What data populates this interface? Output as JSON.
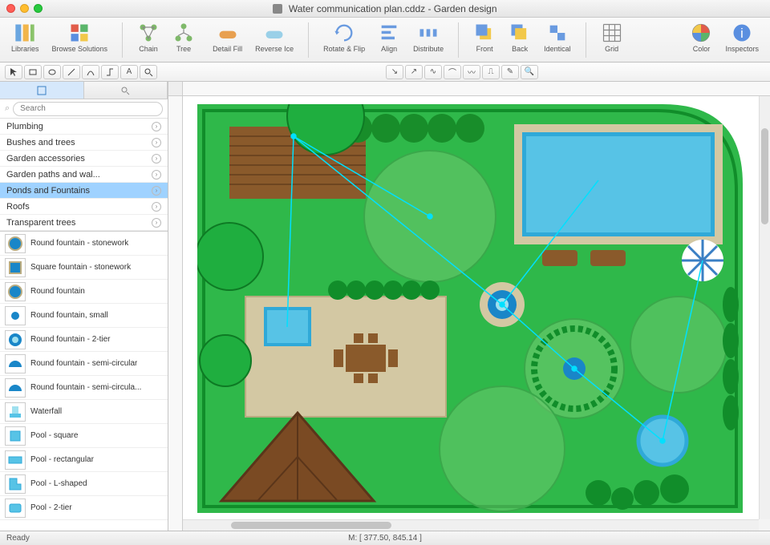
{
  "window": {
    "title": "Water communication plan.cddz - Garden design"
  },
  "toolbar": {
    "libraries": "Libraries",
    "browse": "Browse Solutions",
    "chain": "Chain",
    "tree": "Tree",
    "detailfill": "Detail Fill",
    "reverseice": "Reverse Ice",
    "rotateflip": "Rotate & Flip",
    "align": "Align",
    "distribute": "Distribute",
    "front": "Front",
    "back": "Back",
    "identical": "Identical",
    "grid": "Grid",
    "color": "Color",
    "inspectors": "Inspectors"
  },
  "search": {
    "placeholder": "Search"
  },
  "categories": [
    "Plumbing",
    "Bushes and trees",
    "Garden accessories",
    "Garden paths and wal...",
    "Ponds and Fountains",
    "Roofs",
    "Transparent trees"
  ],
  "selected_category_index": 4,
  "shapes": [
    "Round fountain - stonework",
    "Square fountain - stonework",
    "Round fountain",
    "Round fountain, small",
    "Round fountain - 2-tier",
    "Round fountain - semi-circular",
    "Round fountain - semi-circula...",
    "Waterfall",
    "Pool - square",
    "Pool - rectangular",
    "Pool - L-shaped",
    "Pool - 2-tier"
  ],
  "status": {
    "ready": "Ready",
    "coords": "M: [ 377.50, 845.14 ]"
  },
  "colors": {
    "grass": "#2fb84a",
    "grass_dark": "#118d2a",
    "pool": "#2fa9d8",
    "pool_light": "#9fe0ef",
    "deck": "#8a5a2b",
    "path": "#d3c8a3",
    "roof": "#7a4a23",
    "tree1": "#1fae3f",
    "tree2": "#6fc96f",
    "fountain_blue": "#1986c8"
  }
}
